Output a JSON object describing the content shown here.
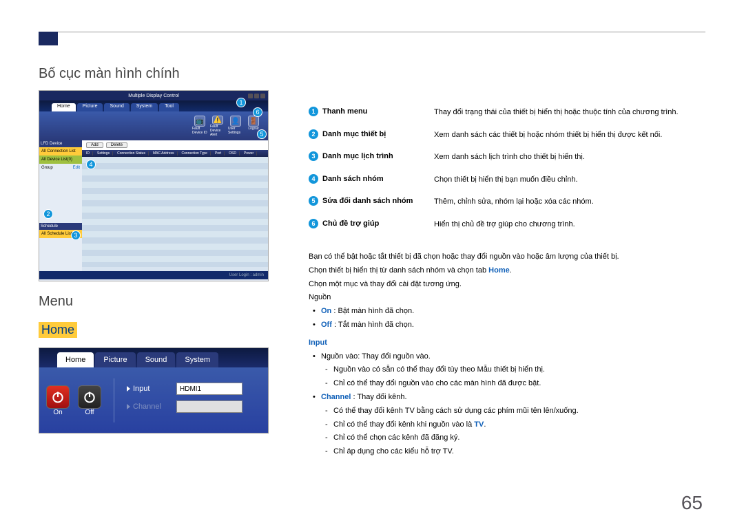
{
  "header": {},
  "left": {
    "title": "Bố cục màn hình chính",
    "mdc": {
      "app_title": "Multiple Display Control",
      "tabs": [
        "Home",
        "Picture",
        "Sound",
        "System",
        "Tool"
      ],
      "toolbar": [
        {
          "label": "Fault Device ID",
          "icon": "📺"
        },
        {
          "label": "Fault Device Alert",
          "icon": "⚠️"
        },
        {
          "label": "User Settings",
          "icon": "👤"
        },
        {
          "label": "Logout",
          "icon": "🚪"
        }
      ],
      "side_pane1": "LFD Device",
      "side_item1": "All Connection List",
      "side_item2": "All Device List(0)",
      "side_grp": "Group",
      "side_edit": "Edit",
      "schedule_hd": "Schedule",
      "schedule_item": "All Schedule List",
      "actions": [
        "Add",
        "Delete"
      ],
      "cols": [
        "ID",
        "Settings",
        "Connection Status",
        "MAC Address",
        "Connection Type",
        "Port",
        "OSD",
        "Power"
      ],
      "status": "User Login : admin"
    },
    "menu_title": "Menu",
    "home": "Home",
    "menushot": {
      "tabs": [
        "Home",
        "Picture",
        "Sound",
        "System"
      ],
      "on": "On",
      "off": "Off",
      "input_label": "Input",
      "input_value": "HDMI1",
      "channel_label": "Channel"
    }
  },
  "right": {
    "rows": [
      {
        "n": "1",
        "k": "Thanh menu",
        "v": "Thay đổi trạng thái của thiết bị hiển thị hoặc thuộc tính của chương trình."
      },
      {
        "n": "2",
        "k": "Danh mục thiết bị",
        "v": "Xem danh sách các thiết bị hoặc nhóm thiết bị hiển thị được kết nối."
      },
      {
        "n": "3",
        "k": "Danh mục lịch trình",
        "v": "Xem danh sách lịch trình cho thiết bị hiển thị."
      },
      {
        "n": "4",
        "k": "Danh sách nhóm",
        "v": "Chọn thiết bị hiển thị bạn muốn điều chỉnh."
      },
      {
        "n": "5",
        "k": "Sửa đổi danh sách nhóm",
        "v": "Thêm, chỉnh sửa, nhóm lại hoặc xóa các nhóm."
      },
      {
        "n": "6",
        "k": "Chủ đề trợ giúp",
        "v": "Hiển thị chủ đề trợ giúp cho chương trình."
      }
    ],
    "p1": "Bạn có thể bật hoặc tắt thiết bị đã chọn hoặc thay đổi nguồn vào hoặc âm lượng của thiết bị.",
    "p2_a": "Chọn thiết bị hiển thị từ danh sách nhóm và chọn tab ",
    "p2_b": "Home",
    "p2_c": ".",
    "p3": "Chọn một mục và thay đổi cài đặt tương ứng.",
    "p4": "Nguồn",
    "on_lbl": "On",
    "on_txt": " : Bật màn hình đã chọn.",
    "off_lbl": "Off",
    "off_txt": " : Tắt màn hình đã chọn.",
    "input_hd": "Input",
    "ib1": "Nguồn vào: Thay đổi nguồn vào.",
    "id1": "Nguồn vào có sẵn có thể thay đổi tùy theo Mẫu thiết bị hiển thị.",
    "id2": "Chỉ có thể thay đổi nguồn vào cho các màn hình đã được bật.",
    "ch_lbl": "Channel",
    "ch_txt": " : Thay đổi kênh.",
    "cd1_a": "Có thể thay đổi kênh TV bằng cách sử dụng các phím mũi tên lên/xuống.",
    "cd2_a": "Chỉ có thể thay đổi kênh khi nguồn vào là ",
    "cd2_b": "TV",
    "cd2_c": ".",
    "cd3": "Chỉ có thể chọn các kênh đã đăng ký.",
    "cd4": "Chỉ áp dụng cho các kiểu hỗ trợ TV."
  },
  "page": "65"
}
